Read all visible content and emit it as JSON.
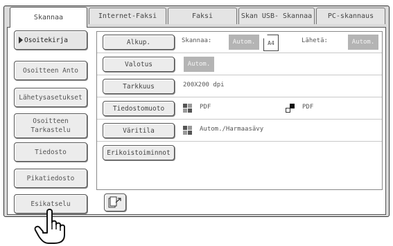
{
  "tabs": [
    {
      "label": "Skannaa",
      "active": true
    },
    {
      "label": "Internet-Faksi",
      "active": false
    },
    {
      "label": "Faksi",
      "active": false
    },
    {
      "label": "Skan USB- Skannaa",
      "active": false
    },
    {
      "label": "PC-skannaus",
      "active": false
    }
  ],
  "sidebar": {
    "items": [
      {
        "label": "Osoitekirja",
        "selected": true
      },
      {
        "label": "Osoitteen Anto"
      },
      {
        "label": "Lähetysasetukset"
      },
      {
        "label": "Osoitteen Tarkastelu"
      },
      {
        "label": "Tiedosto"
      },
      {
        "label": "Pikatiedosto"
      },
      {
        "label": "Esikatselu"
      }
    ]
  },
  "settings": {
    "original": {
      "button": "Alkup.",
      "scan_label": "Skannaa:",
      "scan_value": "Autom.",
      "paper_size": "A4",
      "send_label": "Lähetä:",
      "send_value": "Autom."
    },
    "exposure": {
      "button": "Valotus",
      "value": "Autom."
    },
    "resolution": {
      "button": "Tarkkuus",
      "value": "200X200 dpi"
    },
    "file_format": {
      "button": "Tiedostomuoto",
      "color_value": "PDF",
      "bw_value": "PDF"
    },
    "color_mode": {
      "button": "Väritila",
      "value": "Autom./Harmaasävy"
    },
    "special": {
      "button": "Erikoistoiminnot"
    }
  },
  "icons": {
    "preview": "preview-scan-icon",
    "pointer": "pointing-hand-icon"
  },
  "colors": {
    "auto_box_bg": "#b4b4b4",
    "panel_bg": "#dadada"
  }
}
